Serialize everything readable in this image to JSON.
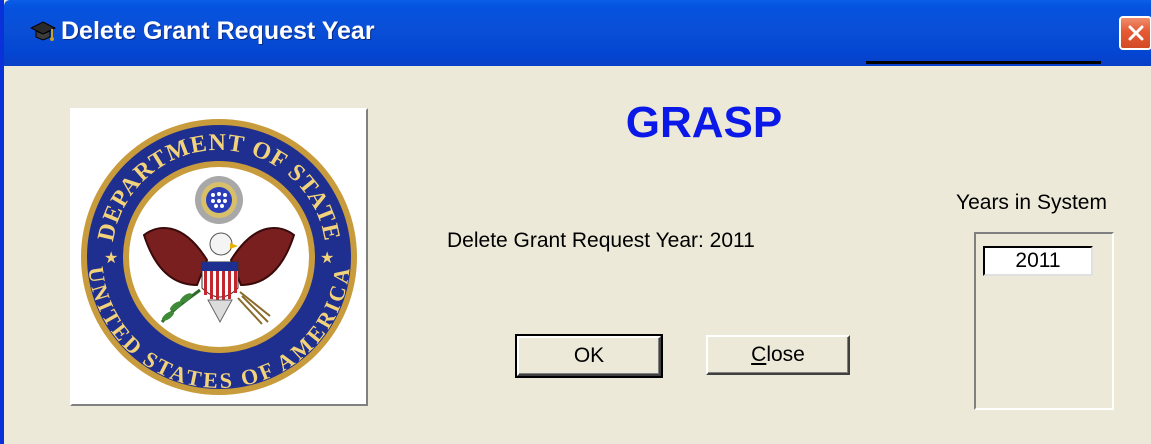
{
  "window": {
    "title": "Delete Grant Request Year",
    "close_icon": "close-icon",
    "title_icon": "graduation-cap-icon"
  },
  "main": {
    "app_title": "GRASP",
    "delete_label": "Delete Grant Request Year: 2011",
    "seal_image": "department-of-state-seal",
    "seal_text_top": "DEPARTMENT OF STATE",
    "seal_text_bottom": "UNITED STATES OF AMERICA"
  },
  "buttons": {
    "ok_label": "OK",
    "close_label_prefix": "",
    "close_label_underlined": "C",
    "close_label_rest": "lose"
  },
  "years": {
    "label": "Years in System",
    "items": [
      "2011"
    ]
  },
  "colors": {
    "titlebar": "#0a4fd6",
    "app_title": "#0a19e8",
    "face": "#ece9d8"
  }
}
